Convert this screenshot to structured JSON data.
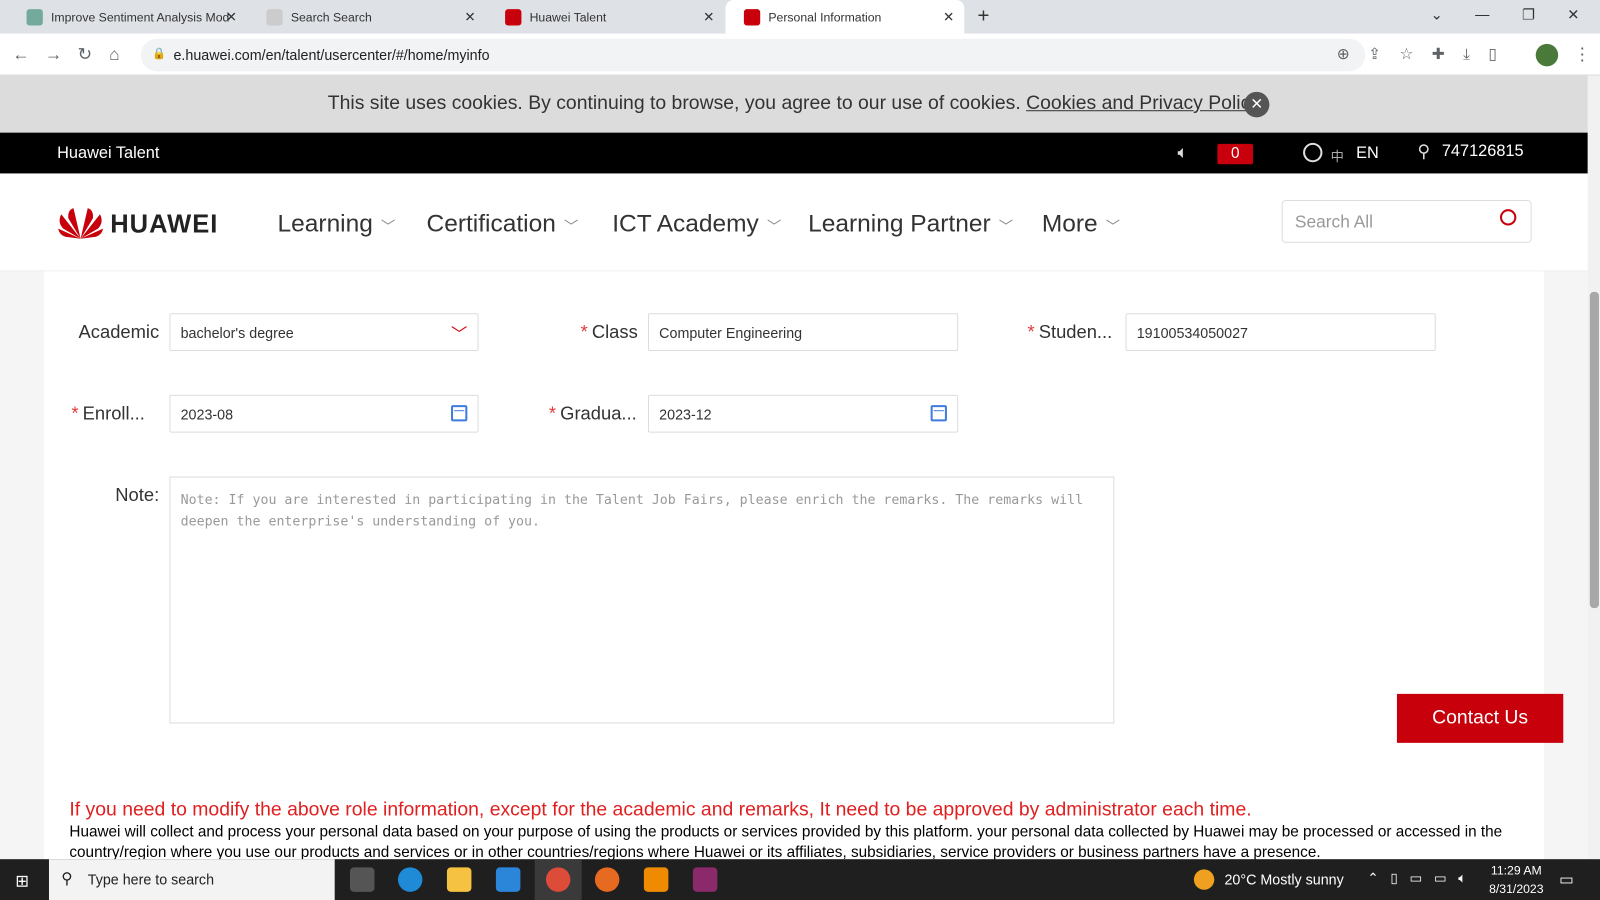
{
  "browser": {
    "tabs": [
      {
        "label": "Improve Sentiment Analysis Mod",
        "active": false
      },
      {
        "label": "Search Search",
        "active": false
      },
      {
        "label": "Huawei Talent",
        "active": false
      },
      {
        "label": "Personal Information",
        "active": true
      }
    ],
    "url": "e.huawei.com/en/talent/usercenter/#/home/myinfo"
  },
  "cookie": {
    "text": "This site uses cookies. By continuing to browse, you agree to our use of cookies. ",
    "link": "Cookies and Privacy Policy"
  },
  "topbar": {
    "brand": "Huawei Talent",
    "notifications": "0",
    "lang_cn": "中",
    "lang_en": "EN",
    "user": "747126815"
  },
  "nav": {
    "logo": "HUAWEI",
    "items": [
      "Learning",
      "Certification",
      "ICT Academy",
      "Learning Partner",
      "More"
    ],
    "search_placeholder": "Search All"
  },
  "form": {
    "academic_label": "Academic",
    "academic_value": "bachelor's degree",
    "class_label": "Class",
    "class_value": "Computer Engineering",
    "student_label": "Studen...",
    "student_value": "19100534050027",
    "enroll_label": "Enroll...",
    "enroll_value": "2023-08",
    "grad_label": "Gradua...",
    "grad_value": "2023-12",
    "note_label": "Note:",
    "note_placeholder": "Note: If you are interested in participating in the Talent Job Fairs, please enrich the remarks. The remarks will deepen the enterprise's understanding of you."
  },
  "contact": "Contact Us",
  "warning": "If you need to modify the above role information, except for the academic and remarks, It need to be approved by administrator each time.",
  "privacy": "Huawei will collect and process your personal data based on your purpose of using the products or services provided by this platform. your personal data collected by Huawei may be processed or accessed in the country/region where you use our products and services or in other countries/regions where Huawei or its affiliates, subsidiaries, service providers or business partners have a presence.",
  "taskbar": {
    "search_placeholder": "Type here to search",
    "weather": "20°C  Mostly sunny",
    "time": "11:29 AM",
    "date": "8/31/2023"
  },
  "colors": {
    "brand": "#c7000b",
    "link": "#3f7be0",
    "warning": "#e02020"
  }
}
